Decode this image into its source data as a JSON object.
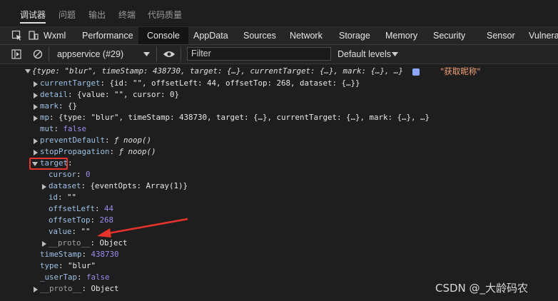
{
  "top_tabs": [
    "调试器",
    "问题",
    "输出",
    "终端",
    "代码质量"
  ],
  "panel_tabs": [
    "Wxml",
    "Performance",
    "Console",
    "AppData",
    "Sources",
    "Network",
    "Storage",
    "Memory",
    "Security",
    "Sensor",
    "Vulnera"
  ],
  "toolbar": {
    "context": "appservice (#29)",
    "filter_value": "Filter",
    "levels": "Default levels"
  },
  "console": {
    "summary": "{type: \"blur\", timeStamp: 438730, target: {…}, currentTarget: {…}, mark: {…}, …}",
    "source_string": "\"获取昵称\"",
    "lines": [
      {
        "key": "currentTarget",
        "value": "{id: \"\", offsetLeft: 44, offsetTop: 268, dataset: {…}}"
      },
      {
        "key": "detail",
        "value": "{value: \"\", cursor: 0}"
      },
      {
        "key": "mark",
        "value": "{}"
      },
      {
        "key": "mp",
        "value": "{type: \"blur\", timeStamp: 438730, target: {…}, currentTarget: {…}, mark: {…}, …}"
      },
      {
        "key": "mut",
        "value": "false"
      },
      {
        "key": "preventDefault",
        "value": "ƒ noop()"
      },
      {
        "key": "stopPropagation",
        "value": "ƒ noop()"
      },
      {
        "key": "target",
        "value": ""
      },
      {
        "key": "cursor",
        "value": "0"
      },
      {
        "key": "dataset",
        "value": "{eventOpts: Array(1)}"
      },
      {
        "key": "id",
        "value": "\"\""
      },
      {
        "key": "offsetLeft",
        "value": "44"
      },
      {
        "key": "offsetTop",
        "value": "268"
      },
      {
        "key": "value",
        "value": "\"\""
      },
      {
        "key": "__proto__",
        "value": "Object"
      },
      {
        "key": "timeStamp",
        "value": "438730"
      },
      {
        "key": "type",
        "value": "\"blur\""
      },
      {
        "key": "_userTap",
        "value": "false"
      },
      {
        "key": "__proto__",
        "value": "Object"
      }
    ]
  },
  "watermark": "CSDN @_大龄码农",
  "colors": {
    "highlight": "#e8322c",
    "arrow": "#e8322c"
  }
}
